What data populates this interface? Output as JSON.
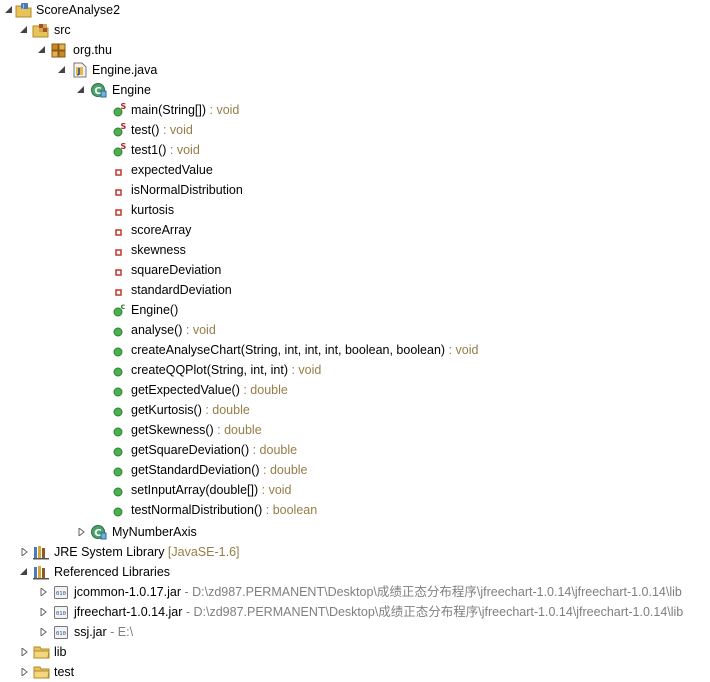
{
  "tree": {
    "project": {
      "label": "ScoreAnalyse2"
    },
    "src": {
      "label": "src"
    },
    "package": {
      "label": "org.thu"
    },
    "file": {
      "label": "Engine.java"
    },
    "class": {
      "label": "Engine"
    },
    "members": [
      {
        "name": "main(String[])",
        "ret": " : void"
      },
      {
        "name": "test()",
        "ret": " : void"
      },
      {
        "name": "test1()",
        "ret": " : void"
      },
      {
        "name": "expectedValue",
        "ret": ""
      },
      {
        "name": "isNormalDistribution",
        "ret": ""
      },
      {
        "name": "kurtosis",
        "ret": ""
      },
      {
        "name": "scoreArray",
        "ret": ""
      },
      {
        "name": "skewness",
        "ret": ""
      },
      {
        "name": "squareDeviation",
        "ret": ""
      },
      {
        "name": "standardDeviation",
        "ret": ""
      },
      {
        "name": "Engine()",
        "ret": ""
      },
      {
        "name": "analyse()",
        "ret": " : void"
      },
      {
        "name": "createAnalyseChart(String, int, int, int, boolean, boolean)",
        "ret": " : void"
      },
      {
        "name": "createQQPlot(String, int, int)",
        "ret": " : void"
      },
      {
        "name": "getExpectedValue()",
        "ret": " : double"
      },
      {
        "name": "getKurtosis()",
        "ret": " : double"
      },
      {
        "name": "getSkewness()",
        "ret": " : double"
      },
      {
        "name": "getSquareDeviation()",
        "ret": " : double"
      },
      {
        "name": "getStandardDeviation()",
        "ret": " : double"
      },
      {
        "name": "setInputArray(double[])",
        "ret": " : void"
      },
      {
        "name": "testNormalDistribution()",
        "ret": " : boolean"
      }
    ],
    "inner_class": {
      "label": "MyNumberAxis"
    },
    "jre": {
      "label": "JRE System Library",
      "suffix": " [JavaSE-1.6]"
    },
    "ref_libs": {
      "label": "Referenced Libraries"
    },
    "jars": [
      {
        "name": "jcommon-1.0.17.jar",
        "path": " - D:\\zd987.PERMANENT\\Desktop\\成绩正态分布程序\\jfreechart-1.0.14\\jfreechart-1.0.14\\lib"
      },
      {
        "name": "jfreechart-1.0.14.jar",
        "path": " - D:\\zd987.PERMANENT\\Desktop\\成绩正态分布程序\\jfreechart-1.0.14\\jfreechart-1.0.14\\lib"
      },
      {
        "name": "ssj.jar",
        "path": " - E:\\"
      }
    ],
    "folders": [
      {
        "label": "lib"
      },
      {
        "label": "test"
      }
    ]
  },
  "colors": {
    "method_public": "#4caf50",
    "field_private": "#c0392b",
    "static_mark": "#b22222",
    "constructor_mark": "#2e7d32",
    "return_type": "#957d47",
    "decoration": "#7f7f7f",
    "folder": "#e8c35a"
  }
}
